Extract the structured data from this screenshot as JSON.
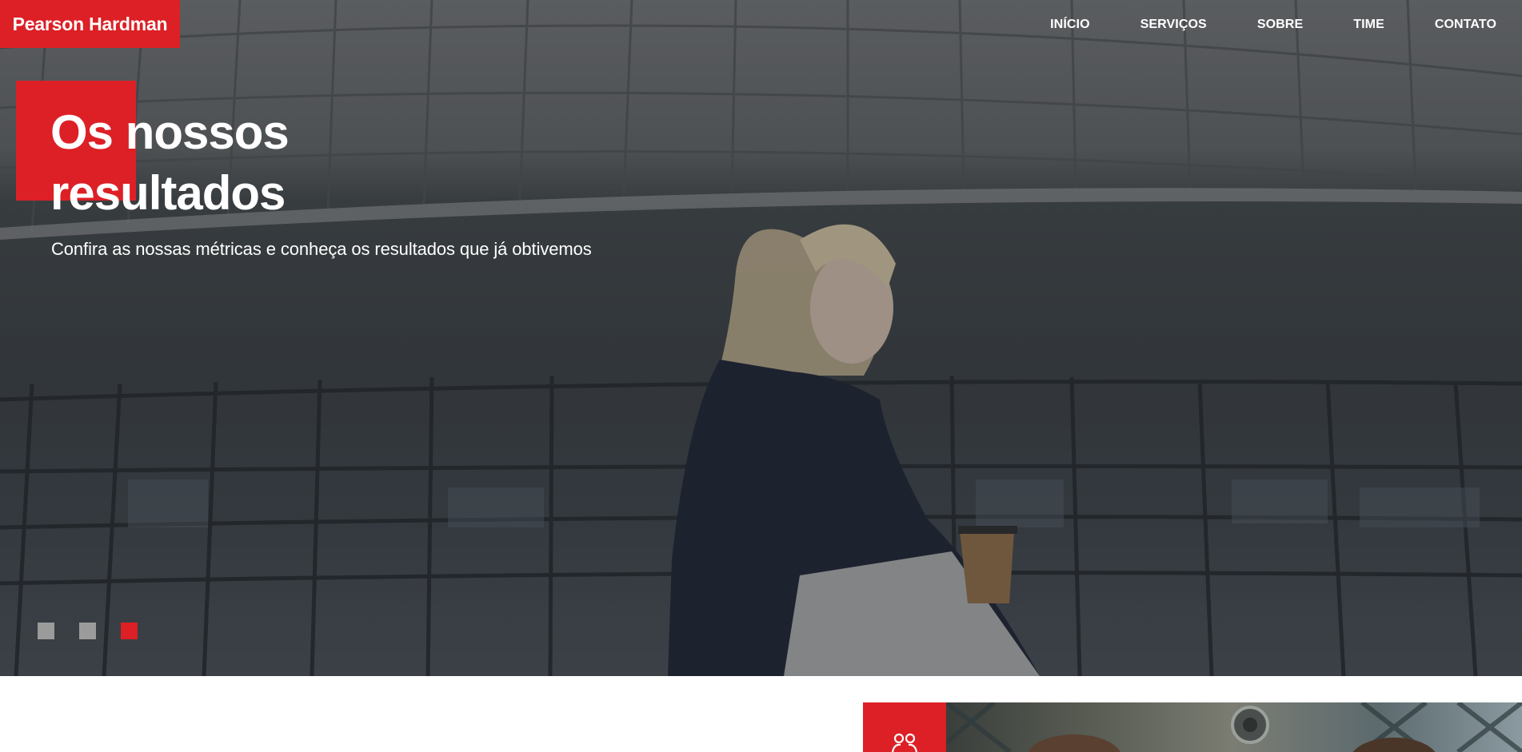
{
  "brand": {
    "name": "Pearson Hardman",
    "accent": "#dc2026"
  },
  "nav": {
    "items": [
      {
        "label": "INÍCIO"
      },
      {
        "label": "SERVIÇOS"
      },
      {
        "label": "SOBRE"
      },
      {
        "label": "TIME"
      },
      {
        "label": "CONTATO"
      }
    ]
  },
  "hero": {
    "title_line1": "Os nossos",
    "title_line2": "resultados",
    "subtitle": "Confira as nossas métricas e conheça os resultados que já obtivemos",
    "slides": {
      "count": 3,
      "active": 3
    }
  },
  "next_section": {
    "icon": "team-icon"
  }
}
